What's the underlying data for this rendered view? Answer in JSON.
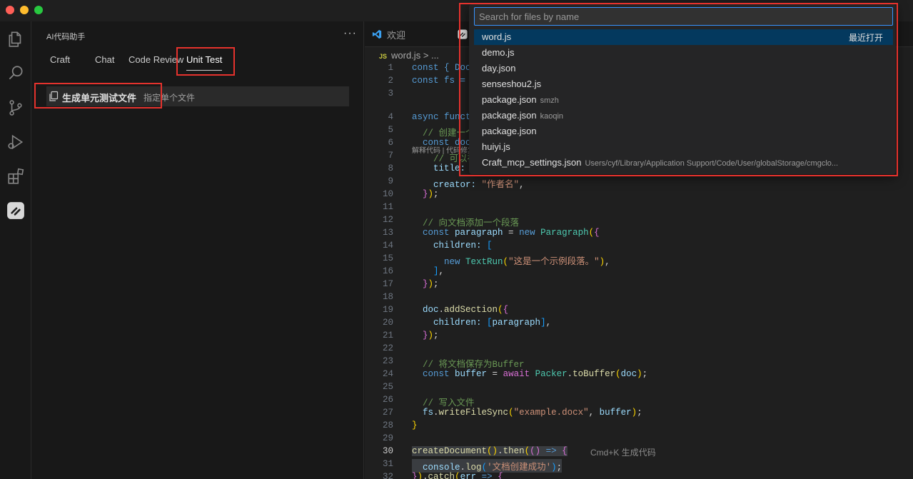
{
  "sidebar": {
    "title": "AI代码助手",
    "more": "···",
    "tabs": [
      {
        "label": "Craft"
      },
      {
        "label": "Chat"
      },
      {
        "label": "Code Review"
      },
      {
        "label": "Unit Test"
      }
    ],
    "unit_test": {
      "label": "生成单元测试文件",
      "hint": "指定单个文件"
    }
  },
  "editor": {
    "tabs": [
      {
        "label": "欢迎",
        "icon": "vscode-logo-icon"
      }
    ],
    "breadcrumb": {
      "file_badge": "JS",
      "file": "word.js",
      "rest": ">  ..."
    },
    "codelens": "解释代码 | 代码修复",
    "inline_hint": "Cmd+K 生成代码"
  },
  "quick_open": {
    "placeholder": "Search for files by name",
    "value": "",
    "items": [
      {
        "name": "word.js",
        "desc": "",
        "right": "最近打开",
        "active": true
      },
      {
        "name": "demo.js",
        "desc": ""
      },
      {
        "name": "day.json",
        "desc": ""
      },
      {
        "name": "senseshou2.js",
        "desc": ""
      },
      {
        "name": "package.json",
        "desc": "smzh"
      },
      {
        "name": "package.json",
        "desc": "kaoqin"
      },
      {
        "name": "package.json",
        "desc": ""
      },
      {
        "name": "huiyi.js",
        "desc": ""
      },
      {
        "name": "Craft_mcp_settings.json",
        "desc": "Users/cyf/Library/Application Support/Code/User/globalStorage/cmgclo..."
      }
    ]
  },
  "code": {
    "lines": [
      {
        "n": "1"
      },
      {
        "n": "2"
      },
      {
        "n": "3"
      },
      {
        "n": "4"
      },
      {
        "n": "5"
      },
      {
        "n": "6"
      },
      {
        "n": "7"
      },
      {
        "n": "8"
      },
      {
        "n": "9"
      },
      {
        "n": "10"
      },
      {
        "n": "11"
      },
      {
        "n": "12"
      },
      {
        "n": "13"
      },
      {
        "n": "14"
      },
      {
        "n": "15"
      },
      {
        "n": "16"
      },
      {
        "n": "17"
      },
      {
        "n": "18"
      },
      {
        "n": "19"
      },
      {
        "n": "20"
      },
      {
        "n": "21"
      },
      {
        "n": "22"
      },
      {
        "n": "23"
      },
      {
        "n": "24"
      },
      {
        "n": "25"
      },
      {
        "n": "26"
      },
      {
        "n": "27"
      },
      {
        "n": "28"
      },
      {
        "n": "29"
      },
      {
        "n": "30"
      },
      {
        "n": "31"
      },
      {
        "n": "32"
      }
    ],
    "text": {
      "l1": "const { Doc",
      "l2": "const fs = ",
      "l4": "async funct",
      "l5": "// 创建一个",
      "l6": "const doc",
      "l7": "// 可以在",
      "l8": "title:",
      "l9a": "creator: ",
      "l9b": "\"作者名\"",
      "l12": "// 向文档添加一个段落",
      "l13a": "const ",
      "l13b": "paragraph",
      "l13c": " = ",
      "l13d": "new ",
      "l13e": "Paragraph",
      "l14": "children: ",
      "l15a": "new ",
      "l15b": "TextRun",
      "l15c": "\"这是一个示例段落。\"",
      "l19a": "doc",
      "l19b": "addSection",
      "l20a": "children: ",
      "l20b": "paragraph",
      "l23": "// 将文档保存为Buffer",
      "l24a": "const ",
      "l24b": "buffer",
      "l24c": " = ",
      "l24d": "await ",
      "l24e": "Packer",
      "l24f": "toBuffer",
      "l24g": "doc",
      "l26": "// 写入文件",
      "l27a": "fs",
      "l27b": "writeFileSync",
      "l27c": "\"example.docx\"",
      "l27d": "buffer",
      "l30a": "createDocument",
      "l30b": "then",
      "l31a": "console",
      "l31b": "log",
      "l31c": "'文档创建成功'",
      "l32a": "catch",
      "l32b": "err"
    }
  }
}
